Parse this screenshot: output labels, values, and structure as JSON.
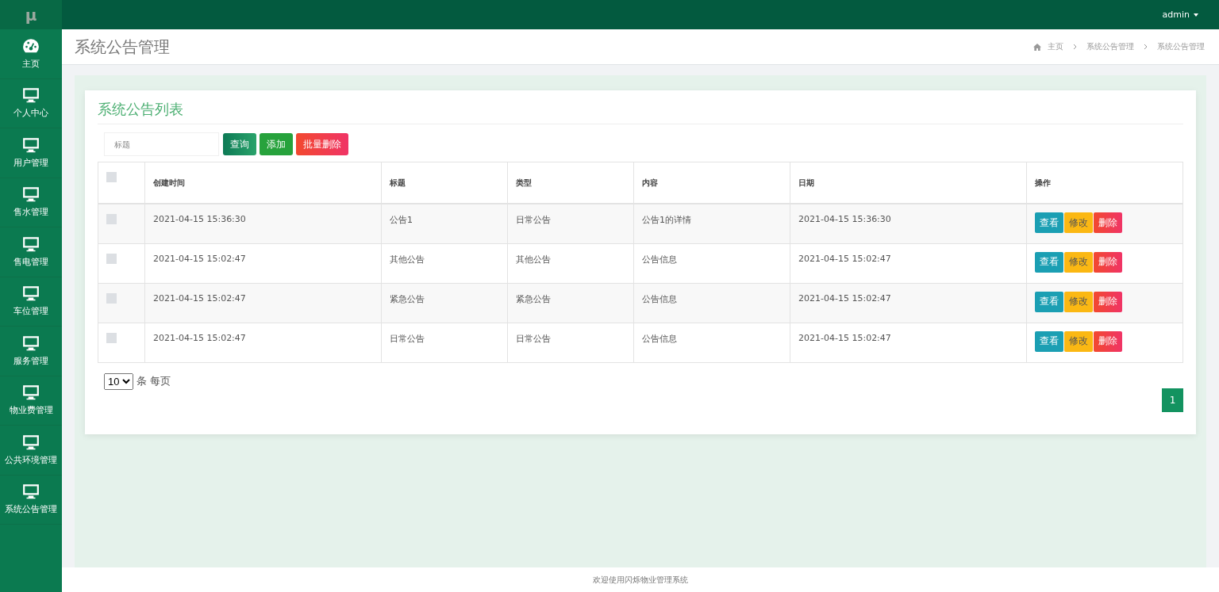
{
  "logo": "μ",
  "user_menu": {
    "label": "admin"
  },
  "sidebar": {
    "items": [
      {
        "label": "主页",
        "selected": false
      },
      {
        "label": "个人中心",
        "selected": false
      },
      {
        "label": "用户管理",
        "selected": false
      },
      {
        "label": "售水管理",
        "selected": false
      },
      {
        "label": "售电管理",
        "selected": false
      },
      {
        "label": "车位管理",
        "selected": false
      },
      {
        "label": "服务管理",
        "selected": false
      },
      {
        "label": "物业费管理",
        "selected": false
      },
      {
        "label": "公共环境管理",
        "selected": false
      },
      {
        "label": "系统公告管理",
        "selected": false
      }
    ]
  },
  "page_title": "系统公告管理",
  "breadcrumb": [
    "主页",
    "系统公告管理",
    "系统公告管理"
  ],
  "panel_title": "系统公告列表",
  "search": {
    "placeholder": "标题"
  },
  "toolbar_buttons": [
    {
      "label": "查询",
      "kind": "query"
    },
    {
      "label": "添加",
      "kind": "add"
    },
    {
      "label": "批量删除",
      "kind": "delete"
    }
  ],
  "table": {
    "select_all": {
      "checked": false
    },
    "columns": [
      "创建时间",
      "标题",
      "类型",
      "内容",
      "日期",
      "操作"
    ],
    "rows": [
      {
        "checked": false,
        "cells": [
          "2021-04-15 15:36:30",
          "公告1",
          "日常公告",
          "公告1的详情",
          "2021-04-15 15:36:30"
        ],
        "actions": [
          {
            "label": "查看",
            "kind": "view"
          },
          {
            "label": "修改",
            "kind": "edit"
          },
          {
            "label": "删除",
            "kind": "delete"
          }
        ]
      },
      {
        "checked": false,
        "cells": [
          "2021-04-15 15:02:47",
          "其他公告",
          "其他公告",
          "公告信息",
          "2021-04-15 15:02:47"
        ],
        "actions": [
          {
            "label": "查看",
            "kind": "view"
          },
          {
            "label": "修改",
            "kind": "edit"
          },
          {
            "label": "删除",
            "kind": "delete"
          }
        ]
      },
      {
        "checked": false,
        "cells": [
          "2021-04-15 15:02:47",
          "紧急公告",
          "紧急公告",
          "公告信息",
          "2021-04-15 15:02:47"
        ],
        "actions": [
          {
            "label": "查看",
            "kind": "view"
          },
          {
            "label": "修改",
            "kind": "edit"
          },
          {
            "label": "删除",
            "kind": "delete"
          }
        ]
      },
      {
        "checked": false,
        "cells": [
          "2021-04-15 15:02:47",
          "日常公告",
          "日常公告",
          "公告信息",
          "2021-04-15 15:02:47"
        ],
        "actions": [
          {
            "label": "查看",
            "kind": "view"
          },
          {
            "label": "修改",
            "kind": "edit"
          },
          {
            "label": "删除",
            "kind": "delete"
          }
        ]
      }
    ]
  },
  "page_size": {
    "value": "10",
    "label": "条 每页"
  },
  "pagination": [
    {
      "label": "1",
      "selected": true
    }
  ],
  "footer": "欢迎使用闪烁物业管理系统"
}
